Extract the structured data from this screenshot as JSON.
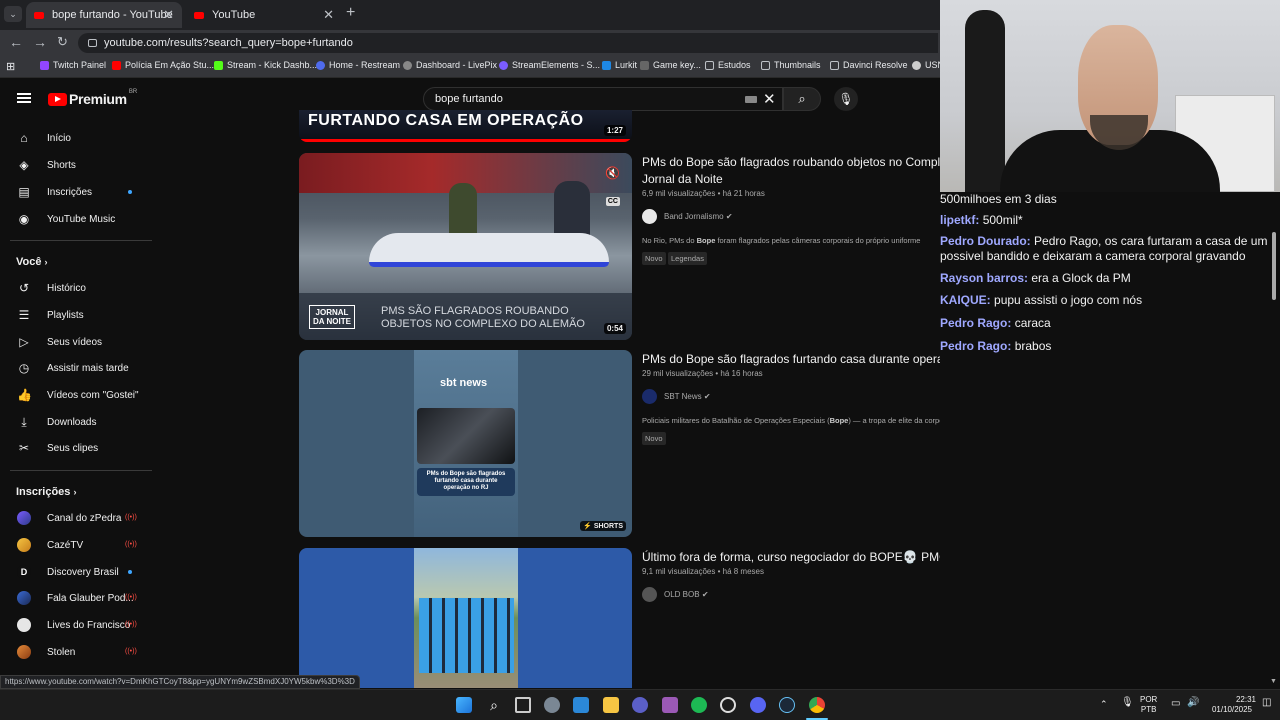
{
  "browser": {
    "tabs": [
      {
        "title": "bope furtando - YouTube",
        "active": true
      },
      {
        "title": "YouTube",
        "active": false
      }
    ],
    "url": "youtube.com/results?search_query=bope+furtando",
    "bookmarks": [
      "Twitch Painel",
      "Polícia Em Ação Stu...",
      "Stream - Kick Dashb...",
      "Home - Restream",
      "Dashboard - LivePix",
      "StreamElements - S...",
      "Lurkit",
      "Game key...",
      "Estudos",
      "Thumbnails",
      "Davinci Resolve",
      "USN"
    ],
    "status_url": "https://www.youtube.com/watch?v=DmKhGTCoyT8&pp=ygUNYm9wZSBmdXJ0YW5kbw%3D%3D"
  },
  "youtube": {
    "logo": "Premium",
    "country": "BR",
    "search_query": "bope furtando",
    "sidebar": {
      "main": [
        {
          "label": "Início",
          "icon": "home-icon"
        },
        {
          "label": "Shorts",
          "icon": "shorts-icon"
        },
        {
          "label": "Inscrições",
          "icon": "subscriptions-icon"
        },
        {
          "label": "YouTube Music",
          "icon": "music-icon"
        }
      ],
      "you_heading": "Você",
      "you": [
        {
          "label": "Histórico",
          "icon": "history-icon"
        },
        {
          "label": "Playlists",
          "icon": "playlists-icon"
        },
        {
          "label": "Seus vídeos",
          "icon": "your-videos-icon"
        },
        {
          "label": "Assistir mais tarde",
          "icon": "watch-later-icon"
        },
        {
          "label": "Vídeos com \"Gostei\"",
          "icon": "like-icon"
        },
        {
          "label": "Downloads",
          "icon": "download-icon"
        },
        {
          "label": "Seus clipes",
          "icon": "scissors-icon"
        }
      ],
      "subs_heading": "Inscrições",
      "subs": [
        {
          "label": "Canal do zPedra",
          "status": "live"
        },
        {
          "label": "CazéTV",
          "status": "live"
        },
        {
          "label": "Discovery Brasil",
          "status": "new"
        },
        {
          "label": "Fala Glauber Pod...",
          "status": "live"
        },
        {
          "label": "Lives do Francisco",
          "status": "live"
        },
        {
          "label": "Stolen",
          "status": "live"
        }
      ]
    },
    "top_thumb": {
      "text": "FURTANDO CASA EM OPERAÇÃO",
      "duration": "1:27"
    },
    "results": [
      {
        "title": "PMs do Bope são flagrados roubando objetos no Compl Jornal da Noite",
        "views": "6,9 mil visualizações",
        "age": "há 21 horas",
        "channel": "Band Jornalismo",
        "desc_prefix": "No Rio, PMs do ",
        "desc_bold": "Bope",
        "desc_suffix": " foram flagrados pelas câmeras corporais do próprio uniforme",
        "badges": [
          "Novo",
          "Legendas"
        ],
        "duration": "0:54",
        "thumb_caption_1": "PMS SÃO FLAGRADOS ROUBANDO",
        "thumb_caption_2": "OBJETOS NO COMPLEXO DO ALEMÃO",
        "thumb_logo": "JORNAL DA NOITE"
      },
      {
        "title": "PMs do Bope são flagrados furtando casa durante operação no RJ | #SBTNotícias",
        "views": "29 mil visualizações",
        "age": "há 16 horas",
        "channel": "SBT News",
        "desc_prefix": "Policiais militares do Batalhão de Operações Especiais (",
        "desc_bold": "Bope",
        "desc_suffix": ") — a tropa de elite da corporação — foram flagrados vasculhando ...",
        "badges": [
          "Novo"
        ],
        "shorts_label": "SHORTS",
        "thumb_brand": "sbt news",
        "thumb_caption": "PMs do Bope são flagrados furtando casa durante operação no RJ"
      },
      {
        "title": "Último fora de forma, curso negociador do BOPE💀 PMGO",
        "views": "9,1 mil visualizações",
        "age": "há 8 meses",
        "channel": "OLD BOB"
      }
    ]
  },
  "chat": [
    {
      "user": "",
      "text": "500milhoes em 3 dias"
    },
    {
      "user": "lipetkf:",
      "text": "500mil*"
    },
    {
      "user": "Pedro Dourado:",
      "text": "Pedro Rago, os cara furtaram a casa de um possivel bandido e deixaram a camera corporal gravando"
    },
    {
      "user": "Rayson barros:",
      "text": "era a Glock da PM"
    },
    {
      "user": "KAIQUE:",
      "text": "pupu assisti o jogo com nós"
    },
    {
      "user": "Pedro Rago:",
      "text": "caraca"
    },
    {
      "user": "Pedro Rago:",
      "text": "brabos"
    }
  ],
  "taskbar": {
    "lang": "POR",
    "layout": "PTB",
    "time": "22:31",
    "date": "01/10/2025"
  }
}
